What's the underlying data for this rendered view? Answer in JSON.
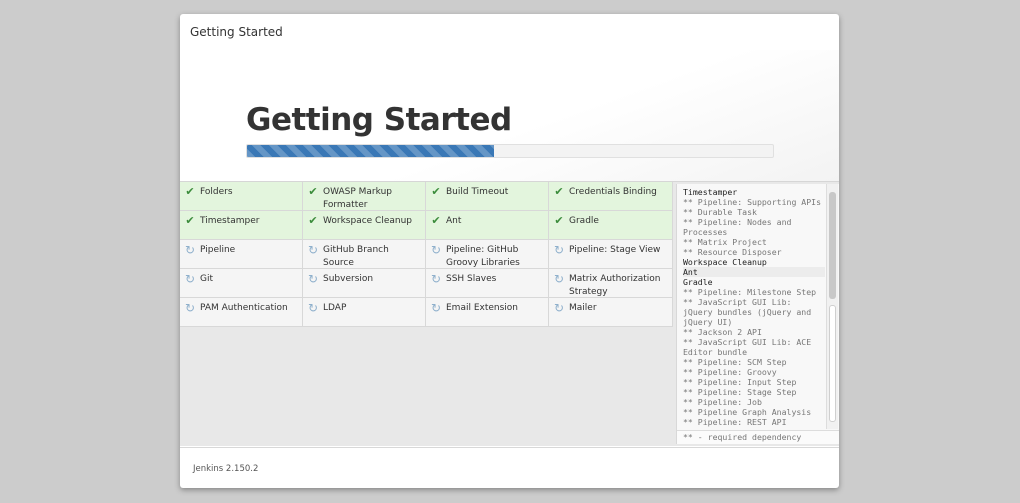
{
  "dialog": {
    "title": "Getting Started",
    "hero_title": "Getting Started",
    "progress_percent": 47
  },
  "plugins": [
    [
      {
        "name": "Folders",
        "status": "success"
      },
      {
        "name": "OWASP Markup Formatter",
        "status": "success"
      },
      {
        "name": "Build Timeout",
        "status": "success"
      },
      {
        "name": "Credentials Binding",
        "status": "success"
      }
    ],
    [
      {
        "name": "Timestamper",
        "status": "success"
      },
      {
        "name": "Workspace Cleanup",
        "status": "success"
      },
      {
        "name": "Ant",
        "status": "success"
      },
      {
        "name": "Gradle",
        "status": "success"
      }
    ],
    [
      {
        "name": "Pipeline",
        "status": "pending"
      },
      {
        "name": "GitHub Branch Source",
        "status": "pending"
      },
      {
        "name": "Pipeline: GitHub Groovy Libraries",
        "status": "pending"
      },
      {
        "name": "Pipeline: Stage View",
        "status": "pending"
      }
    ],
    [
      {
        "name": "Git",
        "status": "pending"
      },
      {
        "name": "Subversion",
        "status": "pending"
      },
      {
        "name": "SSH Slaves",
        "status": "pending"
      },
      {
        "name": "Matrix Authorization Strategy",
        "status": "pending"
      }
    ],
    [
      {
        "name": "PAM Authentication",
        "status": "pending"
      },
      {
        "name": "LDAP",
        "status": "pending"
      },
      {
        "name": "Email Extension",
        "status": "pending"
      },
      {
        "name": "Mailer",
        "status": "pending"
      }
    ]
  ],
  "icons": {
    "success": "checkmark-icon",
    "pending": "refresh-icon"
  },
  "log": {
    "lines": [
      {
        "text": "Timestamper",
        "type": "name"
      },
      {
        "text": "** Pipeline: Supporting APIs",
        "type": "dep"
      },
      {
        "text": "** Durable Task",
        "type": "dep"
      },
      {
        "text": "** Pipeline: Nodes and Processes",
        "type": "dep"
      },
      {
        "text": "** Matrix Project",
        "type": "dep"
      },
      {
        "text": "** Resource Disposer",
        "type": "dep"
      },
      {
        "text": "Workspace Cleanup",
        "type": "name"
      },
      {
        "text": "Ant",
        "type": "name",
        "highlight": true
      },
      {
        "text": "Gradle",
        "type": "name"
      },
      {
        "text": "** Pipeline: Milestone Step",
        "type": "dep"
      },
      {
        "text": "** JavaScript GUI Lib: jQuery bundles (jQuery and jQuery UI)",
        "type": "dep"
      },
      {
        "text": "** Jackson 2 API",
        "type": "dep"
      },
      {
        "text": "** JavaScript GUI Lib: ACE Editor bundle",
        "type": "dep"
      },
      {
        "text": "** Pipeline: SCM Step",
        "type": "dep"
      },
      {
        "text": "** Pipeline: Groovy",
        "type": "dep"
      },
      {
        "text": "** Pipeline: Input Step",
        "type": "dep"
      },
      {
        "text": "** Pipeline: Stage Step",
        "type": "dep"
      },
      {
        "text": "** Pipeline: Job",
        "type": "dep"
      },
      {
        "text": "** Pipeline Graph Analysis",
        "type": "dep"
      },
      {
        "text": "** Pipeline: REST API",
        "type": "dep"
      }
    ],
    "footer": "** - required dependency"
  },
  "footer": {
    "version": "Jenkins 2.150.2"
  },
  "colors": {
    "success_bg": "#e3f5dd",
    "progress": "#3a78b6",
    "check": "#3b8c3b"
  }
}
